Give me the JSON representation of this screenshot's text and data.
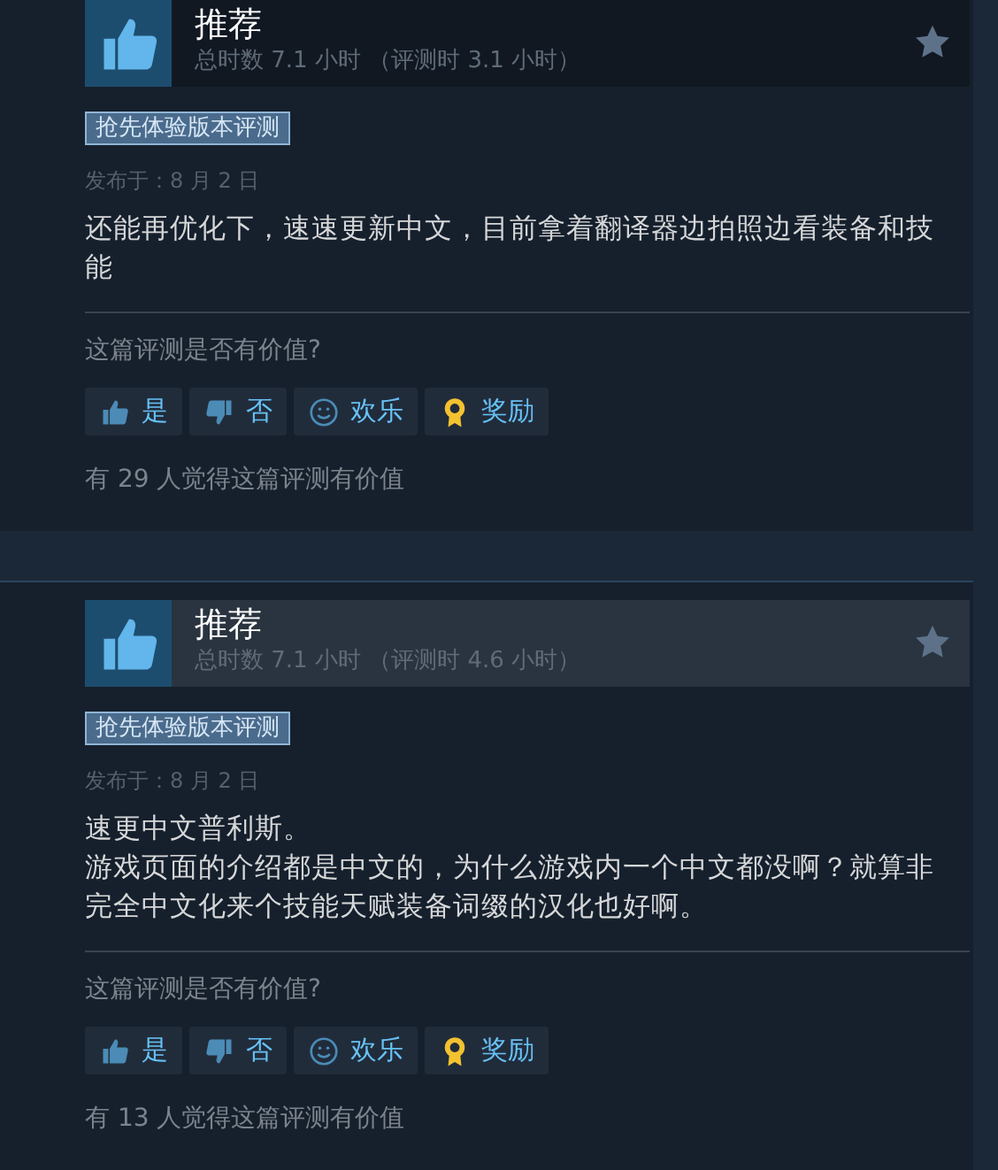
{
  "reviews": [
    {
      "verdict": "推荐",
      "highlighted": false,
      "hours": "总时数 7.1 小时 （评测时 3.1 小时）",
      "tag": "抢先体验版本评测",
      "date": "发布于：8 月 2 日",
      "body": [
        "还能再优化下，速速更新中文，目前拿着翻译器边拍照边看装备和技能"
      ],
      "question": "这篇评测是否有价值?",
      "buttons": [
        {
          "kind": "yes",
          "label": "是"
        },
        {
          "kind": "no",
          "label": "否"
        },
        {
          "kind": "funny",
          "label": "欢乐"
        },
        {
          "kind": "award",
          "label": "奖励"
        }
      ],
      "helpful": "有 29 人觉得这篇评测有价值"
    },
    {
      "verdict": "推荐",
      "highlighted": true,
      "hours": "总时数 7.1 小时 （评测时 4.6 小时）",
      "tag": "抢先体验版本评测",
      "date": "发布于：8 月 2 日",
      "body": [
        "速更中文普利斯。",
        "游戏页面的介绍都是中文的，为什么游戏内一个中文都没啊？就算非完全中文化来个技能天赋装备词缀的汉化也好啊。"
      ],
      "question": "这篇评测是否有价值?",
      "buttons": [
        {
          "kind": "yes",
          "label": "是"
        },
        {
          "kind": "no",
          "label": "否"
        },
        {
          "kind": "funny",
          "label": "欢乐"
        },
        {
          "kind": "award",
          "label": "奖励"
        }
      ],
      "helpful": "有 13 人觉得这篇评测有价值"
    }
  ]
}
